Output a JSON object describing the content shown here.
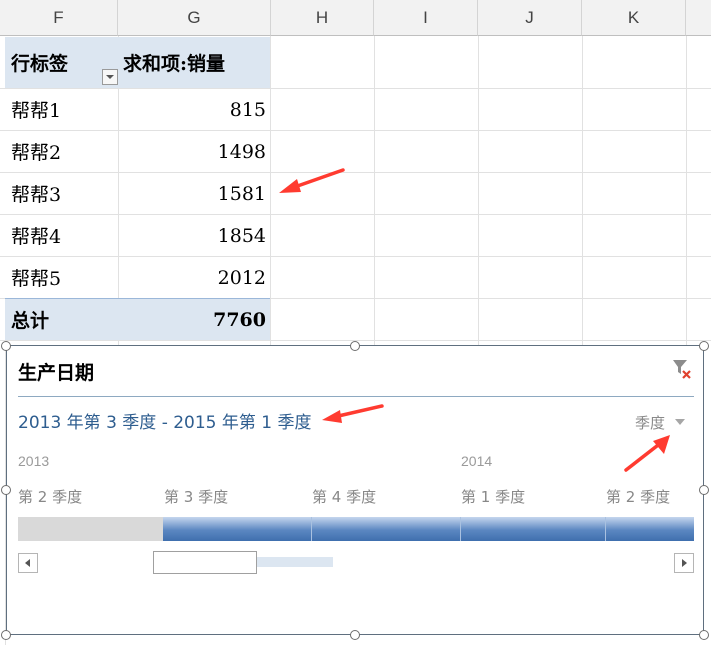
{
  "columns": [
    "F",
    "G",
    "H",
    "I",
    "J",
    "K"
  ],
  "pivot": {
    "header_row_label": "行标签",
    "header_value": "求和项:销量",
    "rows": [
      {
        "label": "帮帮1",
        "value": "815"
      },
      {
        "label": "帮帮2",
        "value": "1498"
      },
      {
        "label": "帮帮3",
        "value": "1581"
      },
      {
        "label": "帮帮4",
        "value": "1854"
      },
      {
        "label": "帮帮5",
        "value": "2012"
      }
    ],
    "total_label": "总计",
    "total_value": "7760"
  },
  "timeline": {
    "title": "生产日期",
    "range_text": "2013 年第 3 季度 - 2015 年第 1 季度",
    "level_label": "季度",
    "years": [
      "2013",
      "2014"
    ],
    "quarters": [
      "第 2 季度",
      "第 3 季度",
      "第 4 季度",
      "第 1 季度",
      "第 2 季度"
    ],
    "selected_from_quarter_index": 1
  },
  "colors": {
    "pivot_header_bg": "#dce6f1",
    "timeline_range_text": "#2e5d8f",
    "timeline_selected": "#4f81bd",
    "annotation_arrow": "#ff3b30"
  }
}
